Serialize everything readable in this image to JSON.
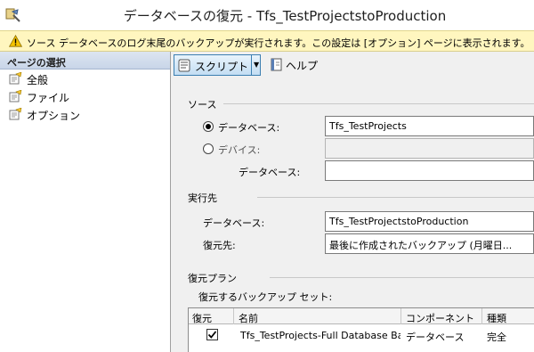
{
  "window": {
    "title": "データベースの復元 - Tfs_TestProjectstoProduction"
  },
  "warning": {
    "text": "ソース データベースのログ末尾のバックアップが実行されます。この設定は [オプション] ページに表示されます。"
  },
  "sidebar": {
    "header": "ページの選択",
    "items": [
      {
        "label": "全般",
        "icon": "page-icon"
      },
      {
        "label": "ファイル",
        "icon": "page-icon"
      },
      {
        "label": "オプション",
        "icon": "page-icon"
      }
    ]
  },
  "toolbar": {
    "script_label": "スクリプト",
    "help_label": "ヘルプ"
  },
  "source": {
    "section_label": "ソース",
    "database_radio_label": "データベース:",
    "database_value": "Tfs_TestProjects",
    "device_radio_label": "デバイス:",
    "device_value": "",
    "device_database_label": "データベース:",
    "device_database_value": "",
    "selected": "database"
  },
  "destination": {
    "section_label": "実行先",
    "database_label": "データベース:",
    "database_value": "Tfs_TestProjectstoProduction",
    "restore_to_label": "復元先:",
    "restore_to_value": "最後に作成されたバックアップ (月曜日..."
  },
  "restore_plan": {
    "section_label": "復元プラン",
    "backup_sets_label": "復元するバックアップ セット:",
    "columns": [
      "復元",
      "名前",
      "コンポーネント",
      "種類"
    ],
    "rows": [
      {
        "restore": true,
        "name": "Tfs_TestProjects-Full Database Ba...",
        "component": "データベース",
        "type": "完全"
      }
    ]
  }
}
